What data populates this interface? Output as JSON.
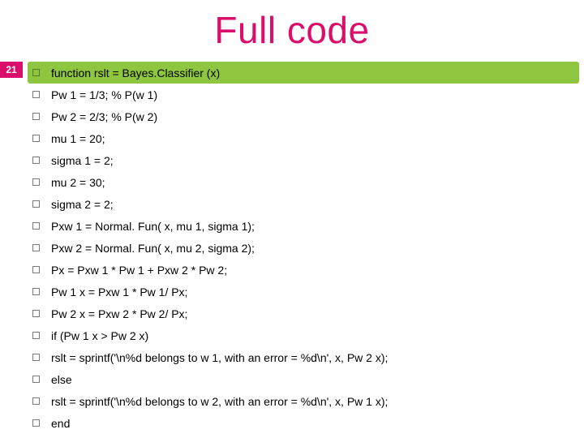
{
  "title": "Full code",
  "slide_number": "21",
  "lines": [
    {
      "text": "function rslt = Bayes.Classifier (x)",
      "highlight": true
    },
    {
      "text": "Pw 1 = 1/3; % P(w 1)",
      "highlight": false
    },
    {
      "text": "Pw 2 = 2/3; % P(w 2)",
      "highlight": false
    },
    {
      "text": "mu 1 = 20;",
      "highlight": false
    },
    {
      "text": "sigma 1 = 2;",
      "highlight": false
    },
    {
      "text": "mu 2 = 30;",
      "highlight": false
    },
    {
      "text": "sigma 2 = 2;",
      "highlight": false
    },
    {
      "text": "Pxw 1 = Normal. Fun( x, mu 1, sigma 1);",
      "highlight": false
    },
    {
      "text": "Pxw 2 = Normal. Fun( x, mu 2, sigma 2);",
      "highlight": false
    },
    {
      "text": "Px = Pxw 1 * Pw 1 + Pxw 2 * Pw 2;",
      "highlight": false
    },
    {
      "text": "Pw 1 x = Pxw 1 * Pw 1/ Px;",
      "highlight": false
    },
    {
      "text": "Pw 2 x = Pxw 2 * Pw 2/ Px;",
      "highlight": false
    },
    {
      "text": "if (Pw 1 x > Pw 2 x)",
      "highlight": false
    },
    {
      "text": "rslt = sprintf('\\n%d belongs to w 1, with an error = %d\\n', x, Pw 2 x);",
      "highlight": false
    },
    {
      "text": "else",
      "highlight": false
    },
    {
      "text": "rslt = sprintf('\\n%d belongs to w 2, with an error = %d\\n', x, Pw 1 x);",
      "highlight": false
    },
    {
      "text": "end",
      "highlight": false
    }
  ]
}
